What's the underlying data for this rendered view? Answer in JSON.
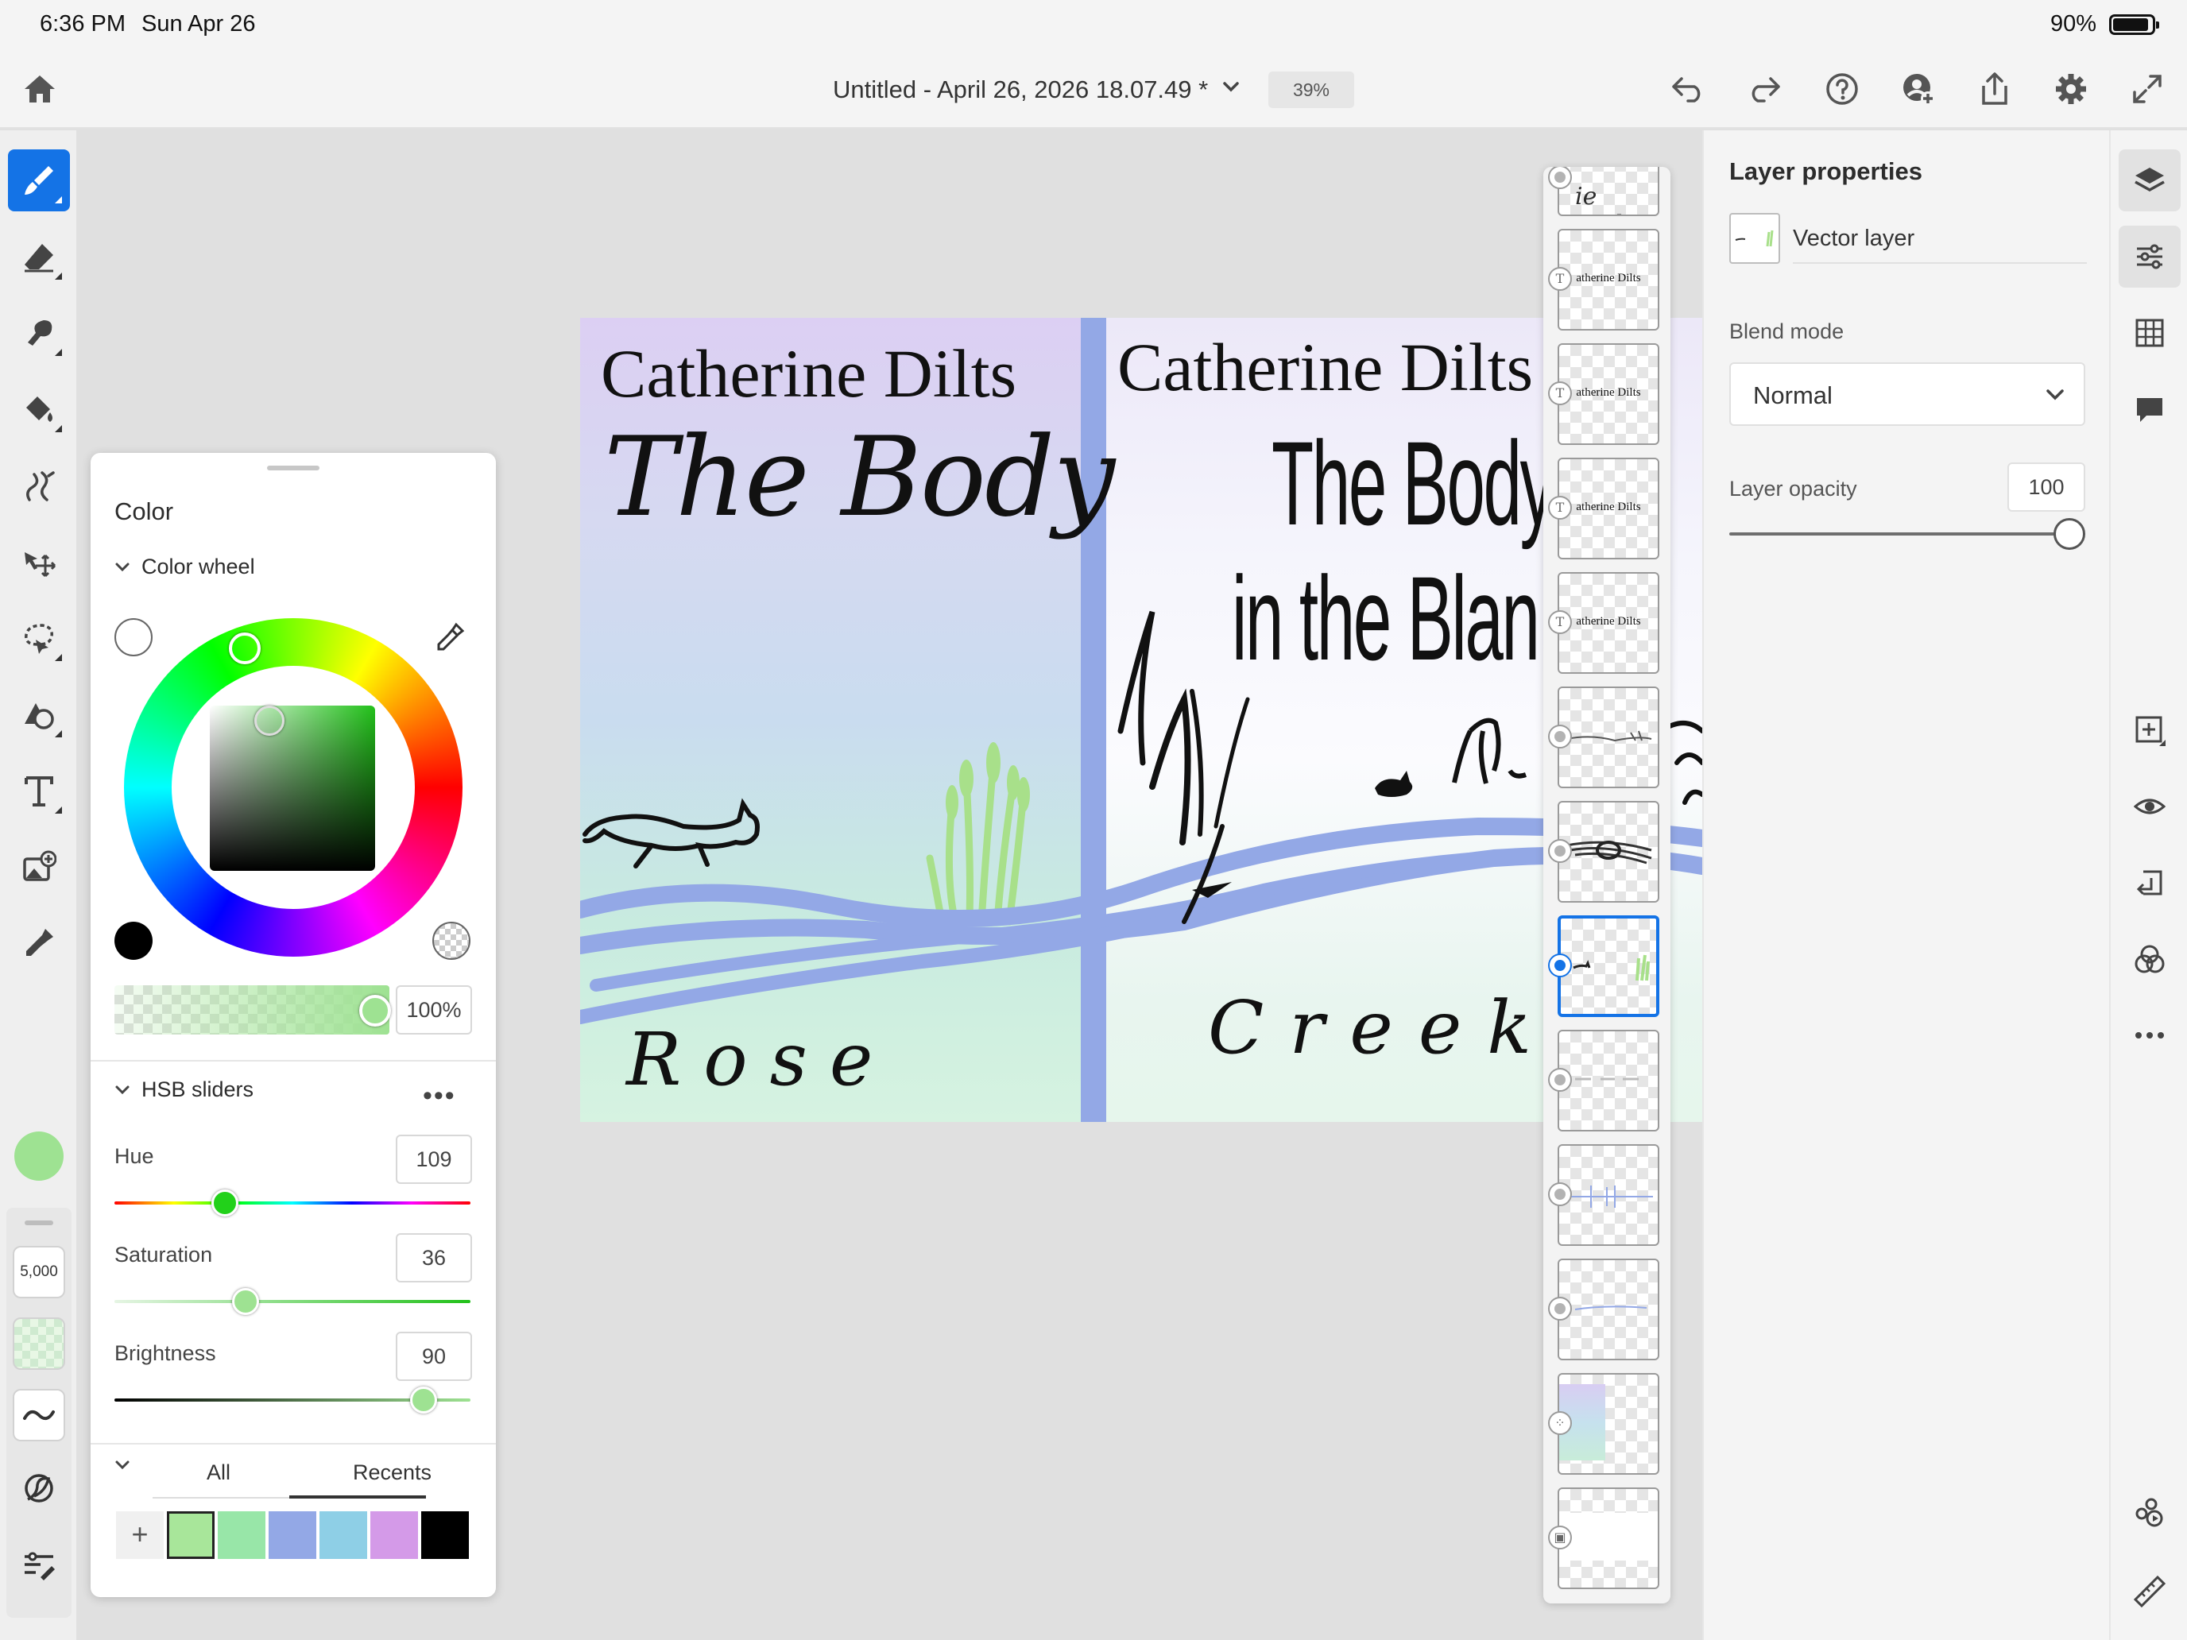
{
  "status_bar": {
    "time": "6:36 PM",
    "date": "Sun Apr 26",
    "battery": "90%"
  },
  "header": {
    "document_title": "Untitled - April 26, 2026 18.07.49 *",
    "zoom": "39%",
    "icons": [
      "home-icon",
      "chevron-down-icon",
      "undo-icon",
      "redo-icon",
      "help-icon",
      "invite-icon",
      "share-icon",
      "settings-icon",
      "expand-icon"
    ]
  },
  "left_toolbar": {
    "tools": [
      "brush-tool",
      "eraser-tool",
      "smudge-tool",
      "fill-tool",
      "liquify-tool",
      "move-tool",
      "lasso-tool",
      "shapes-tool",
      "text-tool",
      "image-tool",
      "eyedropper-tool"
    ],
    "current_color": "#9ee292",
    "brush_size": "5,000"
  },
  "canvas": {
    "author_left": "Catherine Dilts",
    "title_left": "The Body",
    "signature_left": "Rose",
    "author_right": "Catherine Dilts",
    "title_right_1": "The Body",
    "title_right_2": "in the Blan",
    "signature_right": "Creek",
    "colors": {
      "spine": "#93a8e6",
      "grass": "#a8e08a",
      "ink": "#111111"
    }
  },
  "color_panel": {
    "title": "Color",
    "section_wheel": "Color wheel",
    "alpha": "100%",
    "section_sliders": "HSB sliders",
    "more": "•••",
    "hue_label": "Hue",
    "hue_value": "109",
    "saturation_label": "Saturation",
    "saturation_value": "36",
    "brightness_label": "Brightness",
    "brightness_value": "90",
    "tab_all": "All",
    "tab_recents": "Recents",
    "add_swatch": "+",
    "swatches": [
      "#a8e69a",
      "#98e6a8",
      "#93a8e6",
      "#8ecfe6",
      "#d49ae8",
      "#000000"
    ]
  },
  "layers": {
    "thumb_text": "atherine Dilts",
    "items": [
      {
        "type": "text-partial"
      },
      {
        "type": "text",
        "badge": "T"
      },
      {
        "type": "text",
        "badge": "T"
      },
      {
        "type": "text",
        "badge": "T"
      },
      {
        "type": "text",
        "badge": "T"
      },
      {
        "type": "vector"
      },
      {
        "type": "vector"
      },
      {
        "type": "vector",
        "selected": true
      },
      {
        "type": "vector"
      },
      {
        "type": "vector"
      },
      {
        "type": "vector"
      },
      {
        "type": "pixel"
      },
      {
        "type": "image"
      }
    ]
  },
  "layer_properties": {
    "title": "Layer properties",
    "layer_type": "Vector layer",
    "blend_mode_label": "Blend mode",
    "blend_mode": "Normal",
    "opacity_label": "Layer opacity",
    "opacity_value": "100"
  },
  "right_rail": {
    "icons": [
      "layers-icon",
      "adjustments-icon",
      "grid-icon",
      "comments-icon",
      "add-layer-icon",
      "visibility-icon",
      "import-icon",
      "blend-icon",
      "more-icon",
      "libraries-icon",
      "ruler-icon"
    ]
  }
}
